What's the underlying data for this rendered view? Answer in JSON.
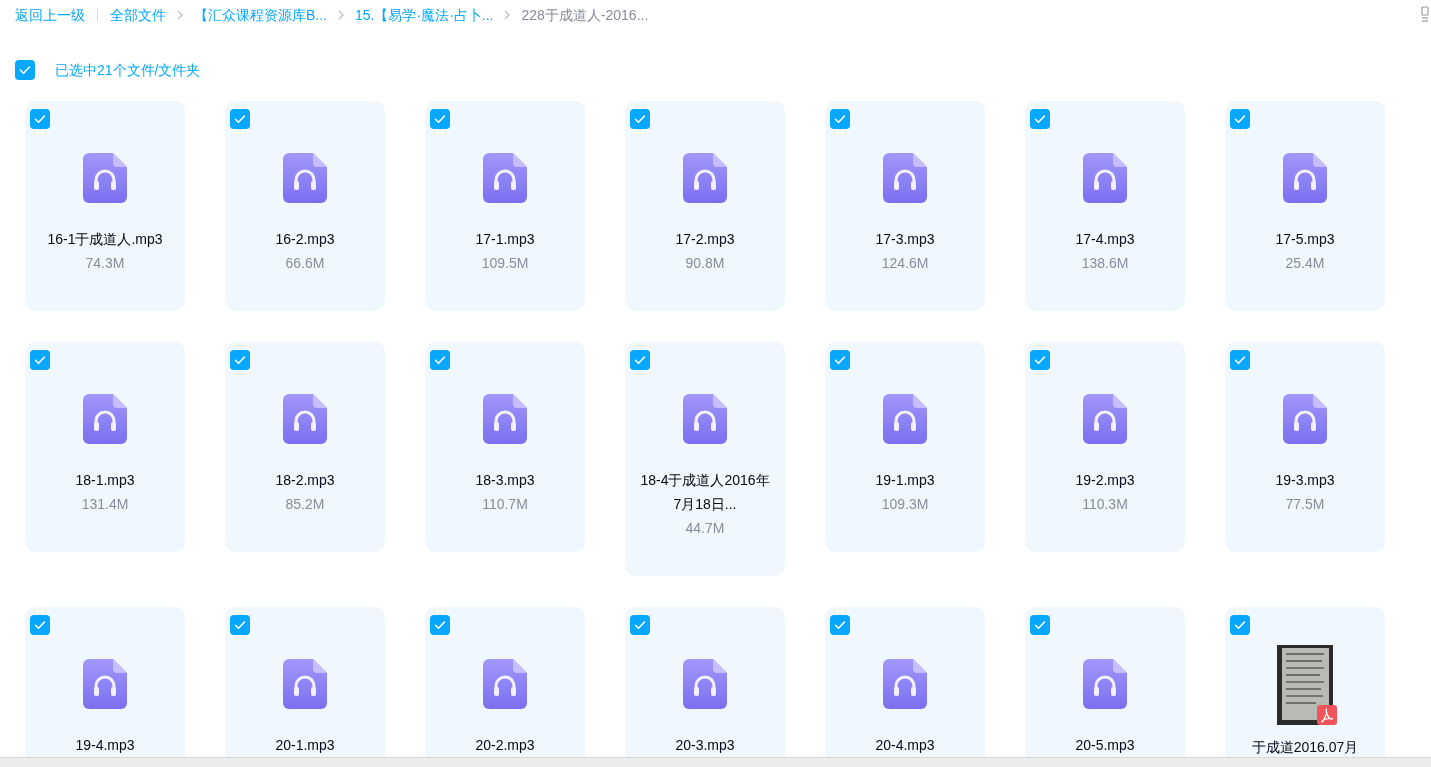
{
  "toolbar": {
    "back": "返回上一级",
    "breadcrumbs": [
      {
        "label": "全部文件",
        "selected": false
      },
      {
        "label": "【汇众课程资源库B...",
        "selected": false
      },
      {
        "label": "15.【易学·魔法·占卜...",
        "selected": false
      },
      {
        "label": "228于成道人-2016...",
        "selected": true
      }
    ]
  },
  "selection": {
    "checked": true,
    "label": "已选中21个文件/文件夹"
  },
  "files": [
    {
      "kind": "audio",
      "name": "16-1于成道人.mp3",
      "size": "74.3M",
      "checked": true
    },
    {
      "kind": "audio",
      "name": "16-2.mp3",
      "size": "66.6M",
      "checked": true
    },
    {
      "kind": "audio",
      "name": "17-1.mp3",
      "size": "109.5M",
      "checked": true
    },
    {
      "kind": "audio",
      "name": "17-2.mp3",
      "size": "90.8M",
      "checked": true
    },
    {
      "kind": "audio",
      "name": "17-3.mp3",
      "size": "124.6M",
      "checked": true
    },
    {
      "kind": "audio",
      "name": "17-4.mp3",
      "size": "138.6M",
      "checked": true
    },
    {
      "kind": "audio",
      "name": "17-5.mp3",
      "size": "25.4M",
      "checked": true
    },
    {
      "kind": "audio",
      "name": "18-1.mp3",
      "size": "131.4M",
      "checked": true
    },
    {
      "kind": "audio",
      "name": "18-2.mp3",
      "size": "85.2M",
      "checked": true
    },
    {
      "kind": "audio",
      "name": "18-3.mp3",
      "size": "110.7M",
      "checked": true
    },
    {
      "kind": "audio",
      "name": "18-4于成道人2016年7月18日...",
      "size": "44.7M",
      "checked": true
    },
    {
      "kind": "audio",
      "name": "19-1.mp3",
      "size": "109.3M",
      "checked": true
    },
    {
      "kind": "audio",
      "name": "19-2.mp3",
      "size": "110.3M",
      "checked": true
    },
    {
      "kind": "audio",
      "name": "19-3.mp3",
      "size": "77.5M",
      "checked": true
    },
    {
      "kind": "audio",
      "name": "19-4.mp3",
      "checked": true
    },
    {
      "kind": "audio",
      "name": "20-1.mp3",
      "checked": true
    },
    {
      "kind": "audio",
      "name": "20-2.mp3",
      "checked": true
    },
    {
      "kind": "audio",
      "name": "20-3.mp3",
      "checked": true
    },
    {
      "kind": "audio",
      "name": "20-4.mp3",
      "checked": true
    },
    {
      "kind": "audio",
      "name": "20-5.mp3",
      "checked": true
    },
    {
      "kind": "pdf",
      "name": "于成道2016.07月",
      "checked": true
    }
  ]
}
